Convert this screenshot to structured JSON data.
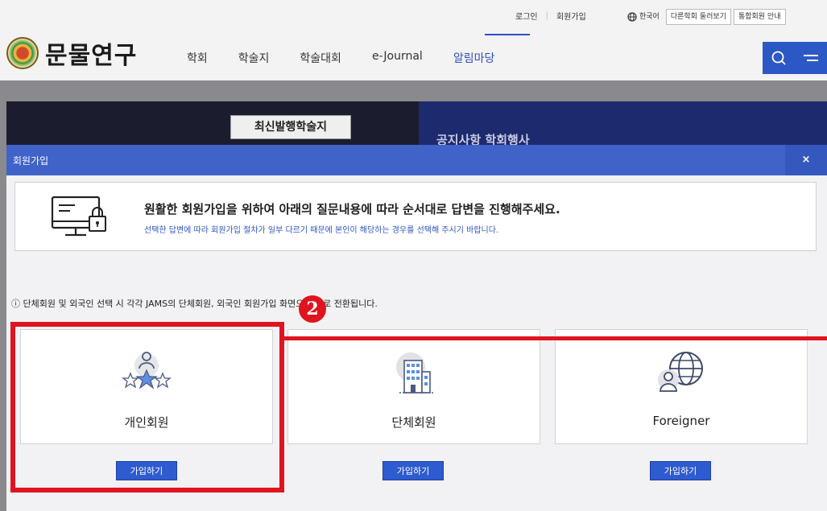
{
  "header": {
    "logo_text": "문물연구",
    "top_links": {
      "login": "로그인",
      "signup": "회원가입"
    },
    "language": "한국어",
    "other_societies": "다른학회 둘러보기",
    "integrated_guide": "통합회원 안내",
    "nav": [
      "학회",
      "학술지",
      "학술대회",
      "e-Journal",
      "알림마당"
    ],
    "active_nav": "알림마당"
  },
  "hero": {
    "tab_label": "최신발행학술지",
    "ghost_text": "공지사항   학회행사"
  },
  "modal": {
    "title": "회원가입",
    "close": "×",
    "notice_main": "원활한 회원가입을 위하여 아래의 질문내용에 따라 순서대로 답변을 진행해주세요.",
    "notice_sub": "선택한 답변에 따라 회원가입 절차가 일부 다르기 때문에 본인이 해당하는 경우를 선택해 주시기 바랍니다.",
    "hint": "ⓘ 단체회원 및 외국인 선택 시 각각 JAMS의 단체회원, 외국인 회원가입 화면으로 바로 전환됩니다.",
    "cards": [
      {
        "label": "개인회원",
        "button": "가입하기",
        "icon": "individual-member-icon"
      },
      {
        "label": "단체회원",
        "button": "가입하기",
        "icon": "organization-building-icon"
      },
      {
        "label": "Foreigner",
        "button": "가입하기",
        "icon": "globe-user-icon"
      }
    ]
  },
  "annotation": {
    "badge": "2",
    "color": "#e0141e"
  },
  "colors": {
    "primary": "#2f5bd0",
    "modal_bar": "#3f63c9",
    "hero_dark": "#1b1c2e"
  }
}
